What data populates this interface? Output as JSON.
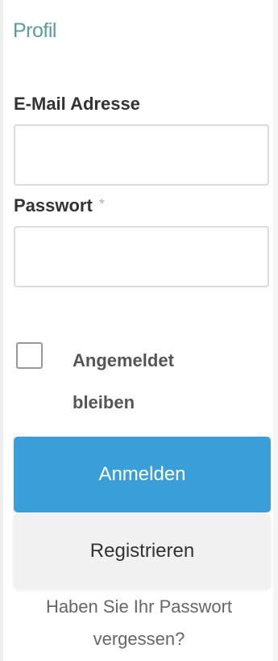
{
  "panel": {
    "title": "Profil"
  },
  "form": {
    "email_label": "E-Mail Adresse",
    "email_value": "",
    "email_placeholder": "",
    "password_label": "Passwort",
    "password_required_marker": "*",
    "password_value": "",
    "password_placeholder": "",
    "remember_line1": "Angemeldet",
    "remember_line2": "bleiben",
    "remember_checked": false,
    "login_button": "Anmelden",
    "register_button": "Registrieren",
    "forgot_line1": "Haben Sie Ihr Passwort",
    "forgot_line2": "vergessen?"
  },
  "colors": {
    "title": "#5a9e9c",
    "primary_button": "#3a9fd9",
    "secondary_button": "#f1f1f1"
  }
}
